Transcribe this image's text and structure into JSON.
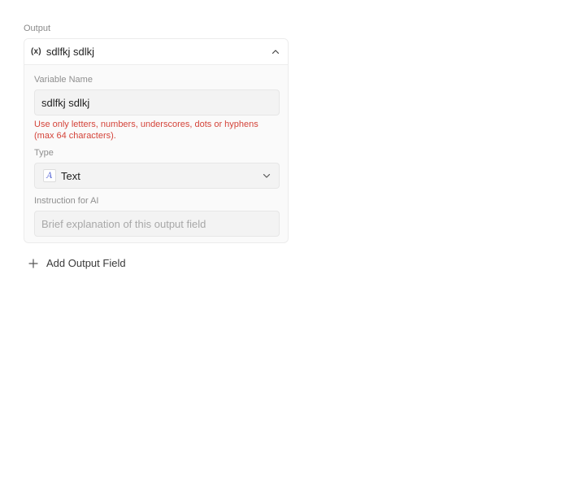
{
  "output_section": {
    "label": "Output",
    "field": {
      "icon": "variable-icon",
      "icon_glyph": "(x)",
      "name": "sdlfkj sdlkj",
      "variable_name": {
        "label": "Variable Name",
        "value": "sdlfkj sdlkj",
        "error": "Use only letters, numbers, underscores, dots or hyphens (max 64 characters)."
      },
      "type": {
        "label": "Type",
        "icon": "text-type-icon",
        "icon_glyph": "A",
        "value": "Text"
      },
      "instruction": {
        "label": "Instruction for AI",
        "value": "",
        "placeholder": "Brief explanation of this output field"
      }
    }
  },
  "add_field": {
    "label": "Add Output Field",
    "icon": "plus-icon"
  },
  "colors": {
    "error": "#d4443a",
    "type_icon": "#5b6bd6",
    "panel_bg": "#fafafa",
    "input_bg": "#f3f3f3"
  }
}
